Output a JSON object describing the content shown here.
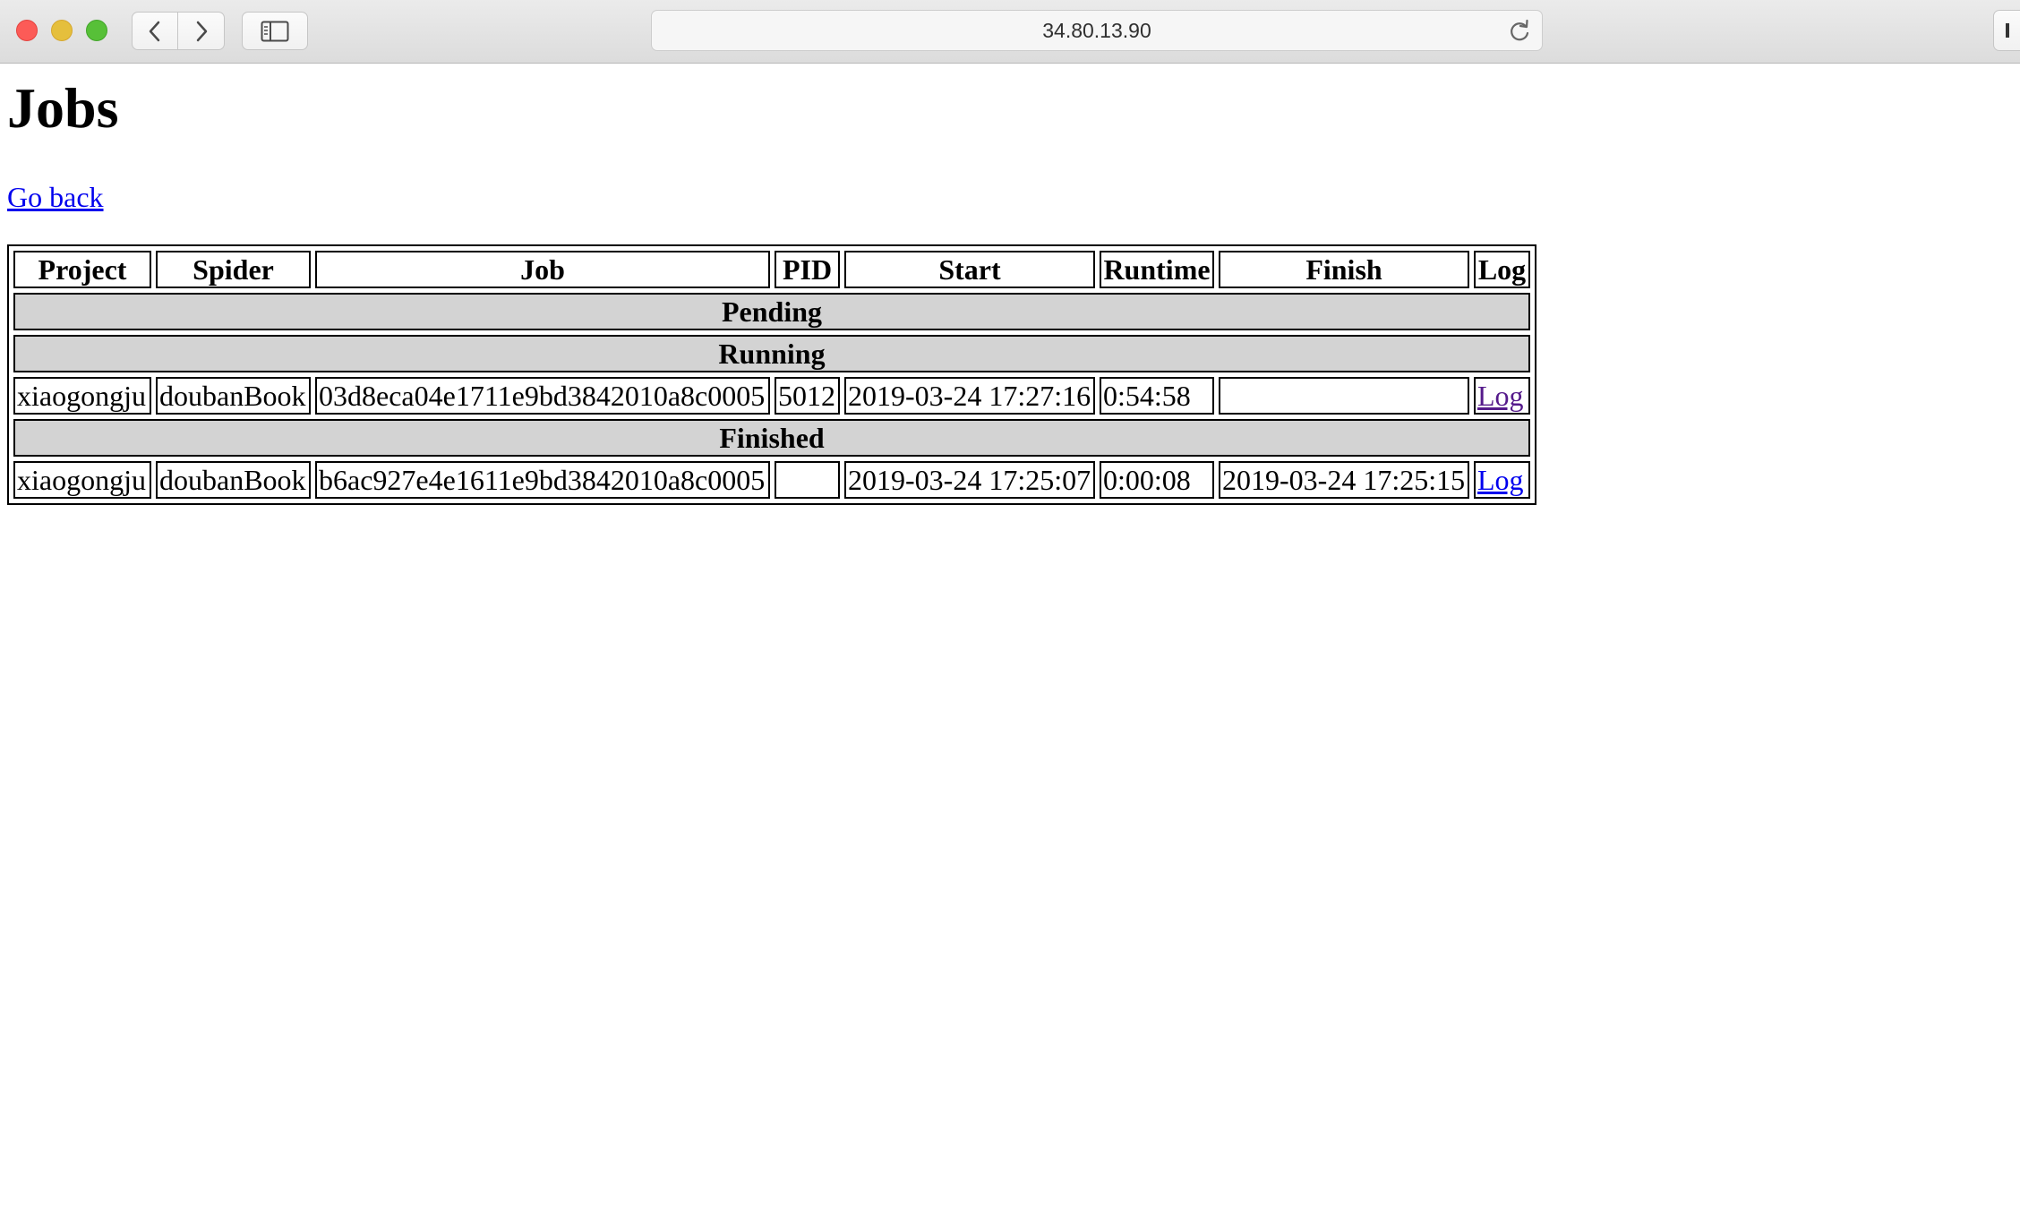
{
  "browser": {
    "address": "34.80.13.90",
    "icons": [
      "back-icon",
      "forward-icon",
      "sidebar-icon",
      "reload-icon"
    ]
  },
  "page": {
    "title": "Jobs",
    "go_back_label": "Go back"
  },
  "table": {
    "headers": [
      "Project",
      "Spider",
      "Job",
      "PID",
      "Start",
      "Runtime",
      "Finish",
      "Log"
    ],
    "sections": {
      "pending": {
        "label": "Pending",
        "rows": []
      },
      "running": {
        "label": "Running",
        "rows": [
          {
            "project": "xiaogongju",
            "spider": "doubanBook",
            "job": "03d8eca04e1711e9bd3842010a8c0005",
            "pid": "5012",
            "start": "2019-03-24 17:27:16",
            "runtime": "0:54:58",
            "finish": "",
            "log": "Log"
          }
        ]
      },
      "finished": {
        "label": "Finished",
        "rows": [
          {
            "project": "xiaogongju",
            "spider": "doubanBook",
            "job": "b6ac927e4e1611e9bd3842010a8c0005",
            "pid": "",
            "start": "2019-03-24 17:25:07",
            "runtime": "0:00:08",
            "finish": "2019-03-24 17:25:15",
            "log": "Log"
          }
        ]
      }
    }
  },
  "colors": {
    "link": "#0000ee",
    "visited_link": "#551a8b",
    "section_bg": "#d3d3d3"
  }
}
